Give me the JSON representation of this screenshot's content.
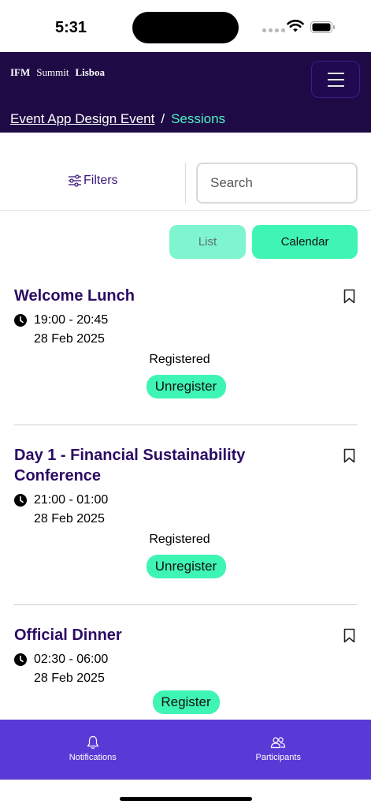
{
  "status_bar": {
    "time": "5:31"
  },
  "header": {
    "brand": {
      "part1": "IFM",
      "part2": "Summit",
      "part3": "Lisboa"
    },
    "menu_icon": "hamburger-icon"
  },
  "breadcrumb": {
    "parent": "Event App Design Event",
    "separator": "/",
    "current": "Sessions"
  },
  "filters": {
    "label": "Filters",
    "icon": "sliders-icon"
  },
  "search": {
    "placeholder": "Search"
  },
  "view_toggle": {
    "list": "List",
    "calendar": "Calendar"
  },
  "sessions": [
    {
      "title": "Welcome Lunch",
      "time": "19:00 - 20:45",
      "date": "28 Feb 2025",
      "status": "Registered",
      "action": "Unregister"
    },
    {
      "title": "Day 1 - Financial Sustainability Conference",
      "time": "21:00 - 01:00",
      "date": "28 Feb 2025",
      "status": "Registered",
      "action": "Unregister"
    },
    {
      "title": "Official Dinner",
      "time": "02:30 - 06:00",
      "date": "28 Feb 2025",
      "status": "",
      "action": "Register"
    }
  ],
  "bottom_nav": [
    {
      "label": "Notifications",
      "icon": "bell-icon"
    },
    {
      "label": "Participants",
      "icon": "people-icon"
    }
  ],
  "colors": {
    "header_bg": "#1e0b45",
    "accent_green": "#3ef5b4",
    "nav_bg": "#5a3ad6",
    "title_purple": "#2b0b63"
  }
}
